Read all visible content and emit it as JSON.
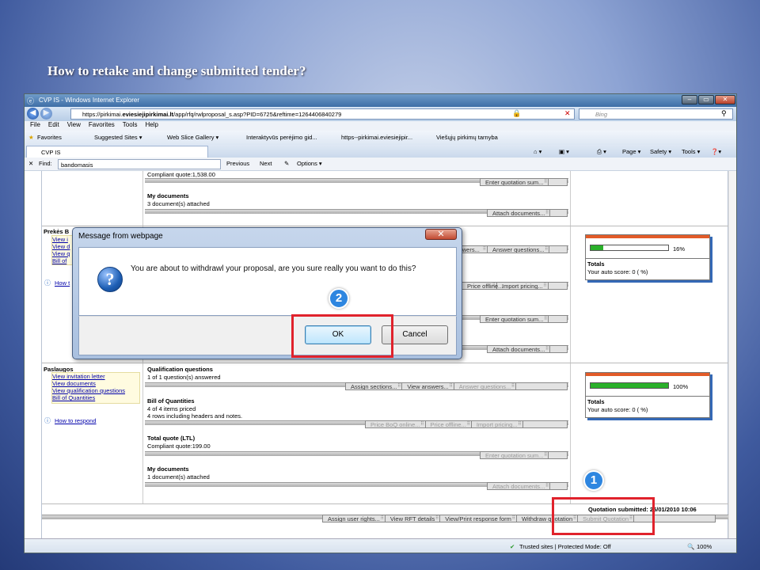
{
  "slide_title": "How to retake and change submitted tender?",
  "browser": {
    "title": "CVP IS - Windows Internet Explorer",
    "url_prefix": "https://pirkimai.",
    "url_domain": "eviesiejipirkimai.lt",
    "url_rest": "/app/rfq/rwlproposal_s.asp?PID=6725&reftime=1264406840279",
    "search_placeholder": "Bing",
    "menu": [
      "File",
      "Edit",
      "View",
      "Favorites",
      "Tools",
      "Help"
    ],
    "favorites_label": "Favorites",
    "favorites": [
      "Suggested Sites ▾",
      "Web Slice Gallery ▾",
      "Interaktyvūs perėjimo gid...",
      "https--pirkimai.eviesiejipir...",
      "Viešųjų pirkimų tarnyba"
    ],
    "tab_label": "CVP IS",
    "tools": [
      "Page ▾",
      "Safety ▾",
      "Tools ▾"
    ],
    "find_label": "Find:",
    "find_value": "bandomasis",
    "find_prev": "Previous",
    "find_next": "Next",
    "find_options": "Options ▾",
    "status_text": "Trusted sites | Protected Mode: Off",
    "zoom": "100%"
  },
  "page": {
    "top": {
      "compliant_quote": "Compliant quote:1,538.00",
      "enter_quotation": "Enter quotation sum...",
      "my_documents": "My documents",
      "docs_attached": "3  document(s) attached",
      "attach_documents": "Attach documents..."
    },
    "section1": {
      "name": "Prekės B",
      "links": [
        "View i",
        "View d",
        "View q",
        "Bill of"
      ],
      "how_to": "How t",
      "answer_questions": "Answer questions...",
      "import_pricing": "Import pricing...",
      "price_offline": "Price offline...",
      "enter_quotation": "Enter quotation sum...",
      "attach_documents": "Attach documents...",
      "progress_label": "16%",
      "progress_value": 16,
      "totals": "Totals",
      "auto_score": "Your auto score: 0 (  %)"
    },
    "section2": {
      "name": "Paslaugos",
      "links": [
        "View invitation letter",
        "View documents",
        "View qualification questions",
        "Bill of Quantities"
      ],
      "how_to": "How to respond",
      "qual_title": "Qualification questions",
      "qual_answered": "1 of  1 question(s) answered",
      "assign_sections": "Assign sections...",
      "view_answers": "View answers...",
      "answer_questions": "Answer questions...",
      "boq_title": "Bill of Quantities",
      "boq_priced": "4 of 4 items priced",
      "boq_rows": "4 rows including headers and notes.",
      "price_boq_online": "Price BoQ online...",
      "price_offline": "Price offline...",
      "import_pricing": "Import pricing...",
      "total_title": "Total quote  (LTL)",
      "compliant_quote": "Compliant quote:199.00",
      "enter_quotation": "Enter quotation sum...",
      "docs_title": "My documents",
      "docs_attached": "1  document(s) attached",
      "attach_documents": "Attach documents...",
      "progress_label": "100%",
      "progress_value": 100,
      "totals": "Totals",
      "auto_score": "Your auto score: 0 (  %)"
    },
    "quotation_submitted": "Quotation submitted: 25/01/2010 10:06",
    "bottom_buttons": [
      "Assign user rights...",
      "View RFT details",
      "View/Print response form",
      "Withdraw quotation",
      "Submit Quotation"
    ]
  },
  "dialog": {
    "title": "Message from webpage",
    "message": "You are about to withdrawl your proposal, are you sure really you want to do this?",
    "ok": "OK",
    "cancel": "Cancel"
  },
  "annotations": {
    "step1": "1",
    "step2": "2"
  },
  "colors": {
    "highlight": "#e0222c",
    "badge": "#2e86e0",
    "progress": "#2ab02a"
  }
}
